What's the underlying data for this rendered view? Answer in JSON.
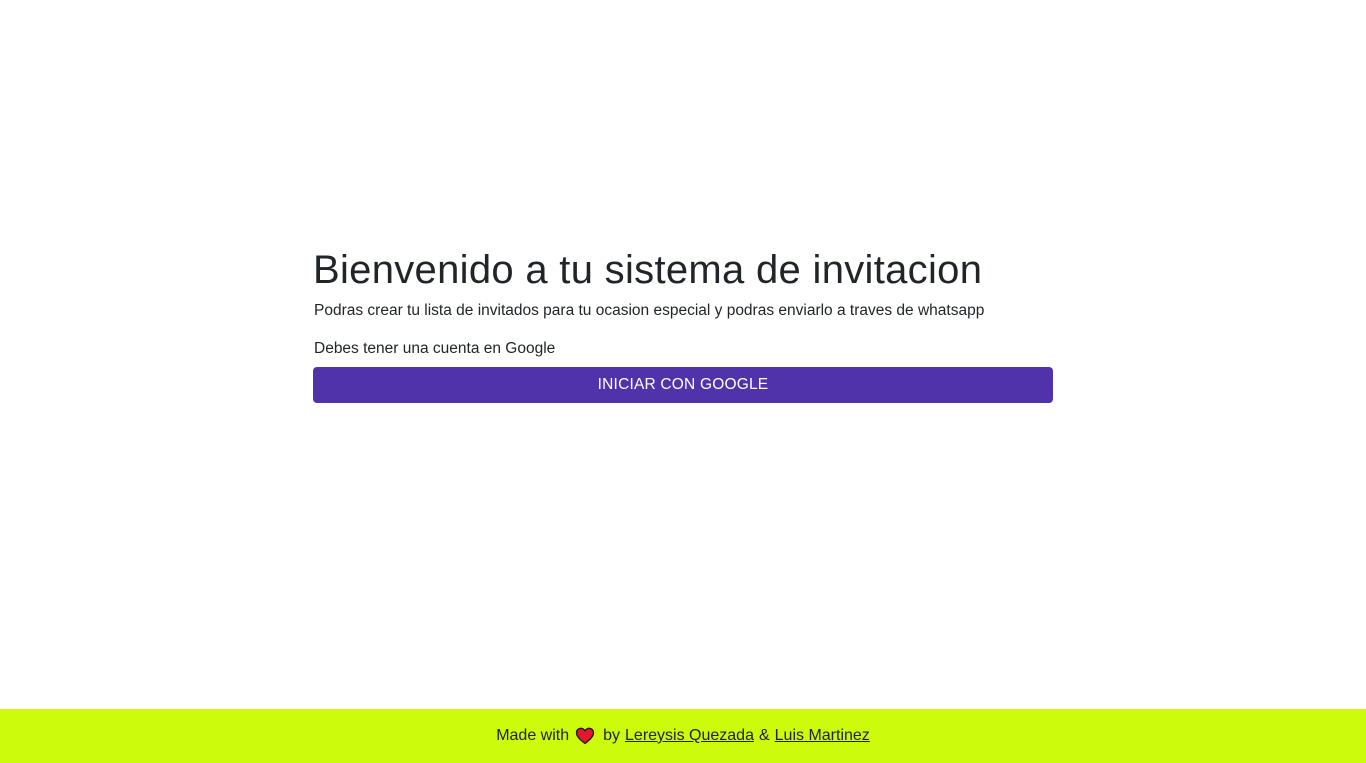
{
  "main": {
    "title": "Bienvenido a tu sistema de invitacion",
    "lead": "Podras crear tu lista de invitados para tu ocasion especial y podras enviarlo a traves de whatsapp",
    "note": "Debes tener una cuenta en Google",
    "google_button_label": "INICIAR CON GOOGLE"
  },
  "footer": {
    "made_with": "Made with",
    "heart_icon": "heart-icon",
    "by": "by",
    "author1": "Lereysis Quezada",
    "ampersand": "&",
    "author2": "Luis Martinez"
  },
  "colors": {
    "button_bg": "#5033ab",
    "footer_bg": "#ccfc0c",
    "heart": "#e3172d"
  }
}
